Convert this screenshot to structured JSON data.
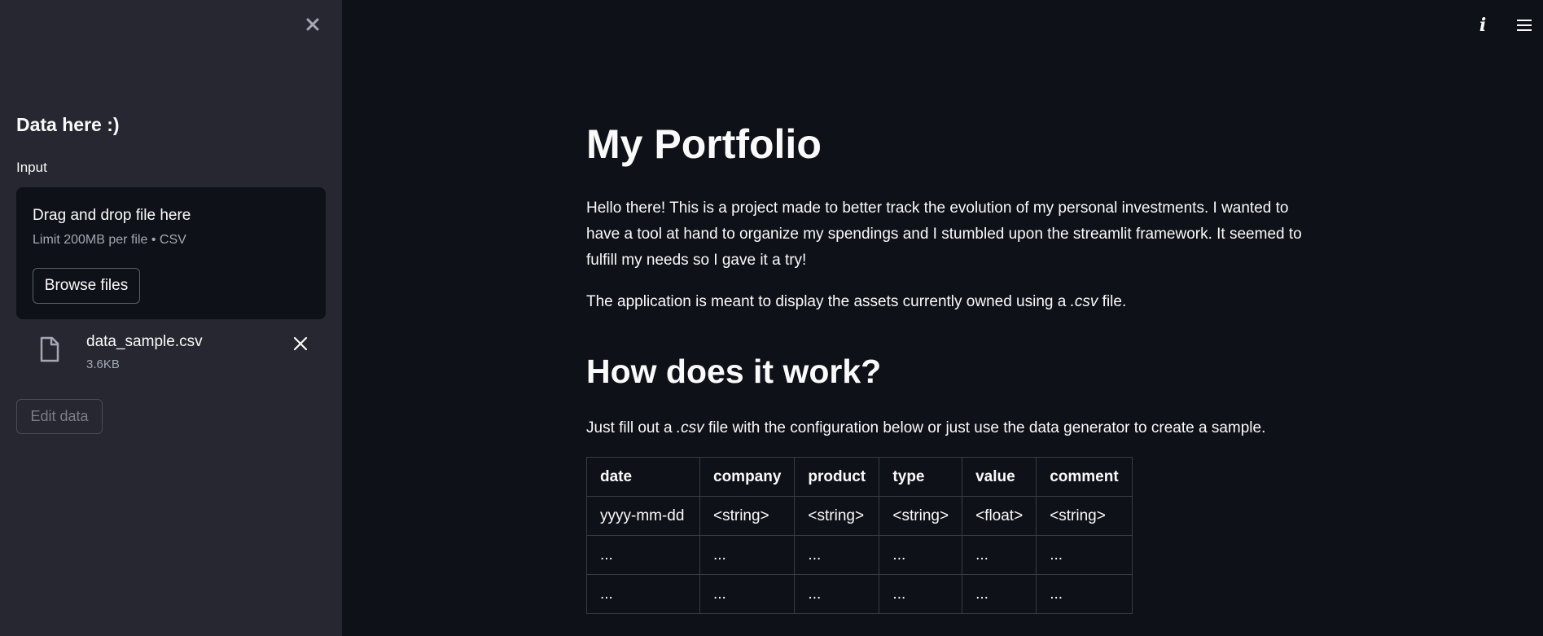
{
  "sidebar": {
    "close_icon": "close-icon",
    "title": "Data here :)",
    "input_label": "Input",
    "dropzone": {
      "text": "Drag and drop file here",
      "limit": "Limit 200MB per file • CSV",
      "browse_label": "Browse files"
    },
    "file": {
      "icon": "file-icon",
      "name": "data_sample.csv",
      "size": "3.6KB"
    },
    "edit_button": "Edit data"
  },
  "toolbar": {
    "info_icon": "info-icon",
    "menu_icon": "hamburger-menu-icon"
  },
  "main": {
    "title": "My Portfolio",
    "intro": "Hello there! This is a project made to better track the evolution of my personal investments. I wanted to have a tool at hand to organize my spendings and I stumbled upon the streamlit framework. It seemed to fulfill my needs so I gave it a try!",
    "desc_before": "The application is meant to display the assets currently owned using a ",
    "desc_em": ".csv",
    "desc_after": " file.",
    "how_title": "How does it work?",
    "how_before": "Just fill out a ",
    "how_em": ".csv",
    "how_after": " file with the configuration below or just use the data generator to create a sample.",
    "table": {
      "headers": [
        "date",
        "company",
        "product",
        "type",
        "value",
        "comment"
      ],
      "rows": [
        [
          "yyyy-mm-dd",
          "<string>",
          "<string>",
          "<string>",
          "<float>",
          "<string>"
        ],
        [
          "...",
          "...",
          "...",
          "...",
          "...",
          "..."
        ],
        [
          "...",
          "...",
          "...",
          "...",
          "...",
          "..."
        ]
      ]
    }
  },
  "colors": {
    "background": "#0e1117",
    "sidebar": "#262730",
    "text": "#fafafa",
    "muted": "#a3a8b4"
  }
}
